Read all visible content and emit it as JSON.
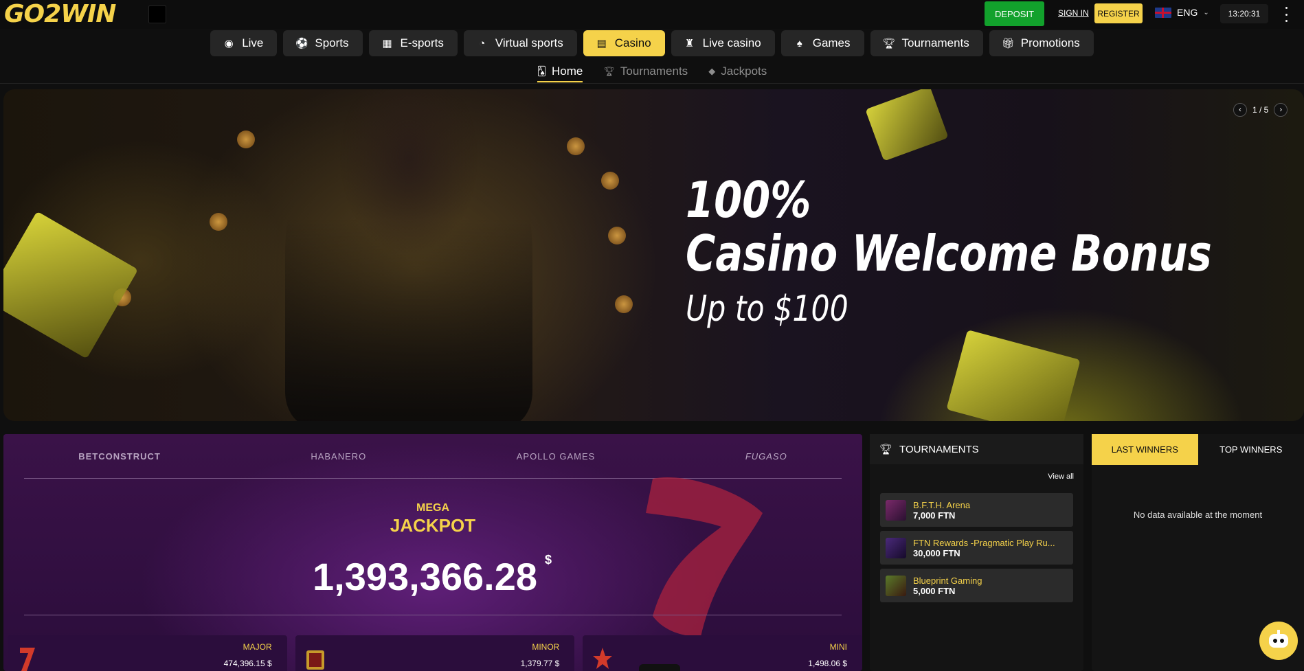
{
  "header": {
    "logo_text": "GO2WIN",
    "deposit_label": "DEPOSIT",
    "signin_label": "SIGN IN",
    "register_label": "REGISTER",
    "language": "ENG",
    "clock": "13:20:31"
  },
  "nav": {
    "items": [
      {
        "label": "Live",
        "icon": "live-icon"
      },
      {
        "label": "Sports",
        "icon": "sports-icon"
      },
      {
        "label": "E-sports",
        "icon": "esports-icon"
      },
      {
        "label": "Virtual sports",
        "icon": "virtual-sports-icon"
      },
      {
        "label": "Casino",
        "icon": "casino-icon",
        "active": true
      },
      {
        "label": "Live casino",
        "icon": "live-casino-icon"
      },
      {
        "label": "Games",
        "icon": "games-icon"
      },
      {
        "label": "Tournaments",
        "icon": "trophy-icon"
      },
      {
        "label": "Promotions",
        "icon": "gift-icon"
      }
    ]
  },
  "subnav": {
    "items": [
      {
        "label": "Home",
        "icon": "home-card-icon",
        "active": true
      },
      {
        "label": "Tournaments",
        "icon": "trophy-icon"
      },
      {
        "label": "Jackpots",
        "icon": "diamond-icon"
      }
    ]
  },
  "banner": {
    "line1": "100%",
    "line2": "Casino Welcome Bonus",
    "line3": "Up to $100",
    "pager": "1 / 5"
  },
  "jackpot": {
    "providers": [
      "BETCONSTRUCT",
      "HABANERO",
      "APOLLO GAMES",
      "FUGASO"
    ],
    "mega_label": "MEGA",
    "title": "JACKPOT",
    "amount": "1,393,366.28",
    "currency": "$",
    "tiers": [
      {
        "name": "MAJOR",
        "value": "474,396.15 $"
      },
      {
        "name": "MINOR",
        "value": "1,379.77 $"
      },
      {
        "name": "MINI",
        "value": "1,498.06 $"
      }
    ]
  },
  "tournaments": {
    "title": "TOURNAMENTS",
    "view_all": "View all",
    "items": [
      {
        "name": "B.F.T.H. Arena",
        "prize": "7,000 FTN"
      },
      {
        "name": "FTN Rewards -Pragmatic Play Ru...",
        "prize": "30,000 FTN"
      },
      {
        "name": "Blueprint Gaming",
        "prize": "5,000 FTN"
      }
    ]
  },
  "winners": {
    "tab_last": "LAST WINNERS",
    "tab_top": "TOP WINNERS",
    "empty": "No data available at the moment"
  },
  "colors": {
    "accent": "#f5d24a",
    "deposit": "#12a12c",
    "background": "#0f0f0f"
  }
}
